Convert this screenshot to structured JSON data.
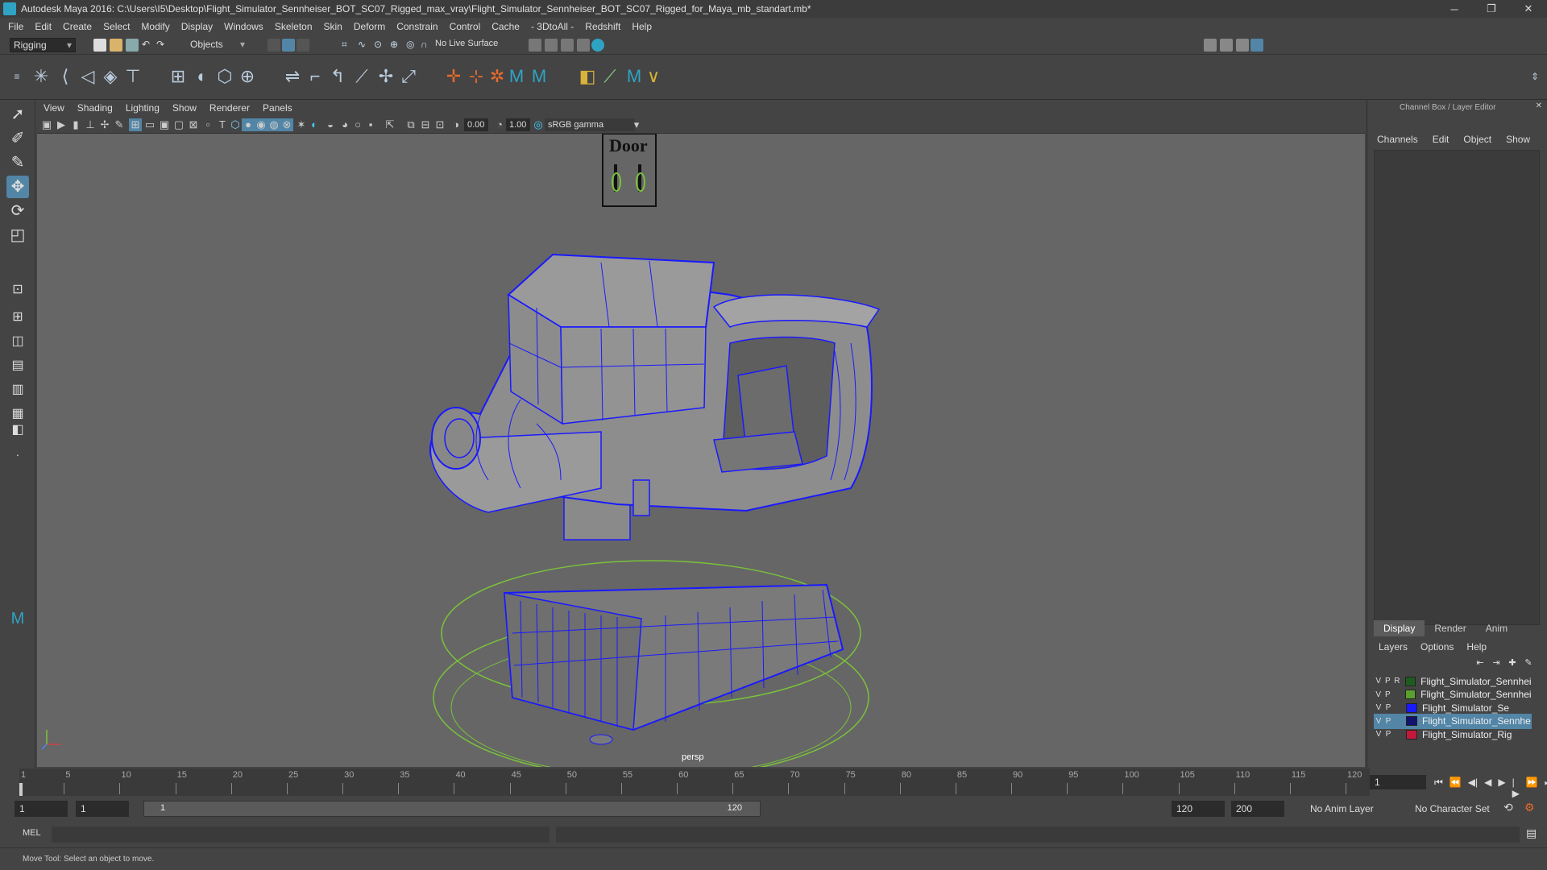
{
  "titlebar": {
    "title": "Autodesk Maya 2016: C:\\Users\\I5\\Desktop\\Flight_Simulator_Sennheiser_BOT_SC07_Rigged_max_vray\\Flight_Simulator_Sennheiser_BOT_SC07_Rigged_for_Maya_mb_standart.mb*",
    "minimize": "─",
    "maximize": "❐",
    "close": "✕"
  },
  "menubar": [
    "File",
    "Edit",
    "Create",
    "Select",
    "Modify",
    "Display",
    "Windows",
    "Skeleton",
    "Skin",
    "Deform",
    "Constrain",
    "Control",
    "Cache",
    "- 3DtoAll -",
    "Redshift",
    "Help"
  ],
  "statusline": {
    "mode": "Rigging",
    "selection_mode": "Objects",
    "live_surface": "No Live Surface"
  },
  "panel": {
    "menus": [
      "View",
      "Shading",
      "Lighting",
      "Show",
      "Renderer",
      "Panels"
    ],
    "exposure": "0.00",
    "gamma": "1.00",
    "color_space": "sRGB gamma",
    "camera": "persp"
  },
  "viewport_text": {
    "door_label": "Door"
  },
  "channelbox": {
    "title": "Channel Box / Layer Editor",
    "menus": [
      "Channels",
      "Edit",
      "Object",
      "Show"
    ],
    "tabs": [
      "Display",
      "Render",
      "Anim"
    ],
    "layer_menus": [
      "Layers",
      "Options",
      "Help"
    ],
    "layers": [
      {
        "v": "V",
        "p": "P",
        "r": "R",
        "color": "#1e5c1e",
        "name": "Flight_Simulator_Sennheis"
      },
      {
        "v": "V",
        "p": "P",
        "r": "",
        "color": "#5aa02c",
        "name": "Flight_Simulator_Sennheis"
      },
      {
        "v": "V",
        "p": "P",
        "r": "",
        "color": "#1a1aff",
        "name": "Flight_Simulator_Se"
      },
      {
        "v": "V",
        "p": "P",
        "r": "",
        "color": "#121270",
        "name": "Flight_Simulator_Sennhe"
      },
      {
        "v": "V",
        "p": "P",
        "r": "",
        "color": "#c4183a",
        "name": "Flight_Simulator_Rig"
      }
    ]
  },
  "timeline": {
    "ticks": [
      1,
      5,
      10,
      15,
      20,
      25,
      30,
      35,
      40,
      45,
      50,
      55,
      60,
      65,
      70,
      75,
      80,
      85,
      90,
      95,
      100,
      105,
      110,
      115,
      120
    ],
    "current_frame": "1"
  },
  "range": {
    "start": "1",
    "anim_start": "1",
    "range_start_label": "1",
    "range_end_label": "120",
    "end": "120",
    "anim_end": "200",
    "anim_layer": "No Anim Layer",
    "character_set": "No Character Set"
  },
  "cmdline": {
    "label": "MEL"
  },
  "helpline": {
    "text": "Move Tool: Select an object to move."
  },
  "colors": {
    "accent": "#5285a6",
    "wire": "#1a1aff",
    "rig": "#7ac23a"
  }
}
